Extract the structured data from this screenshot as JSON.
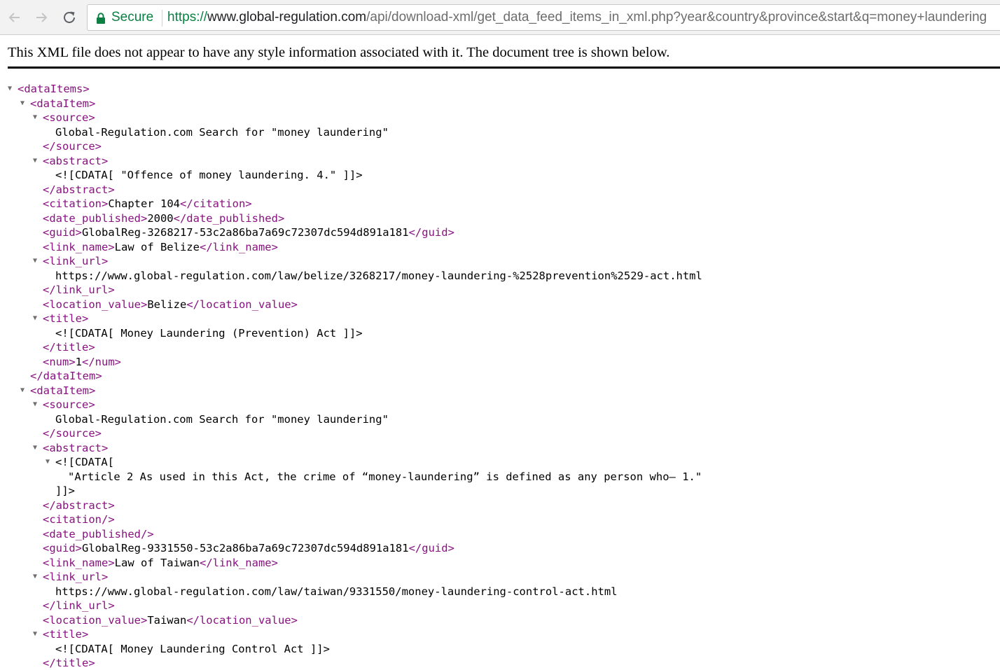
{
  "browser": {
    "secure_label": "Secure",
    "url_scheme": "https://",
    "url_host": "www.global-regulation.com",
    "url_rest": "/api/download-xml/get_data_feed_items_in_xml.php?year&country&province&start&q=money+laundering"
  },
  "notice": "This XML file does not appear to have any style information associated with it. The document tree is shown below.",
  "tags": {
    "dataItems_open": "<dataItems>",
    "dataItem_open": "<dataItem>",
    "dataItem_close": "</dataItem>",
    "source_open": "<source>",
    "source_close": "</source>",
    "abstract_open": "<abstract>",
    "abstract_close": "</abstract>",
    "citation_open": "<citation>",
    "citation_close": "</citation>",
    "citation_empty": "<citation/>",
    "date_open": "<date_published>",
    "date_close": "</date_published>",
    "date_empty": "<date_published/>",
    "guid_open": "<guid>",
    "guid_close": "</guid>",
    "link_name_open": "<link_name>",
    "link_name_close": "</link_name>",
    "link_url_open": "<link_url>",
    "link_url_close": "</link_url>",
    "location_open": "<location_value>",
    "location_close": "</location_value>",
    "title_open": "<title>",
    "title_close": "</title>",
    "num_open": "<num>",
    "num_close": "</num>",
    "cdata_open": "<![CDATA[",
    "cdata_close": "]]>"
  },
  "items": [
    {
      "source": "Global-Regulation.com Search for \"money laundering\"",
      "abstract_cdata": "<![CDATA[ \"Offence of money laundering. 4.\" ]]>",
      "citation": "Chapter 104",
      "date_published": "2000",
      "guid": "GlobalReg-3268217-53c2a86ba7a69c72307dc594d891a181",
      "link_name": "Law of Belize",
      "link_url": "https://www.global-regulation.com/law/belize/3268217/money-laundering-%2528prevention%2529-act.html",
      "location_value": "Belize",
      "title_cdata": "<![CDATA[ Money Laundering (Prevention) Act ]]>",
      "num": "1"
    },
    {
      "source": "Global-Regulation.com Search for \"money laundering\"",
      "abstract_text": "\"Article 2 As used in this Act, the crime of “money-laundering” is defined as any person who— 1.\"",
      "guid": "GlobalReg-9331550-53c2a86ba7a69c72307dc594d891a181",
      "link_name": "Law of Taiwan",
      "link_url": "https://www.global-regulation.com/law/taiwan/9331550/money-laundering-control-act.html",
      "location_value": "Taiwan",
      "title_cdata": "<![CDATA[ Money Laundering Control Act ]]>"
    }
  ]
}
